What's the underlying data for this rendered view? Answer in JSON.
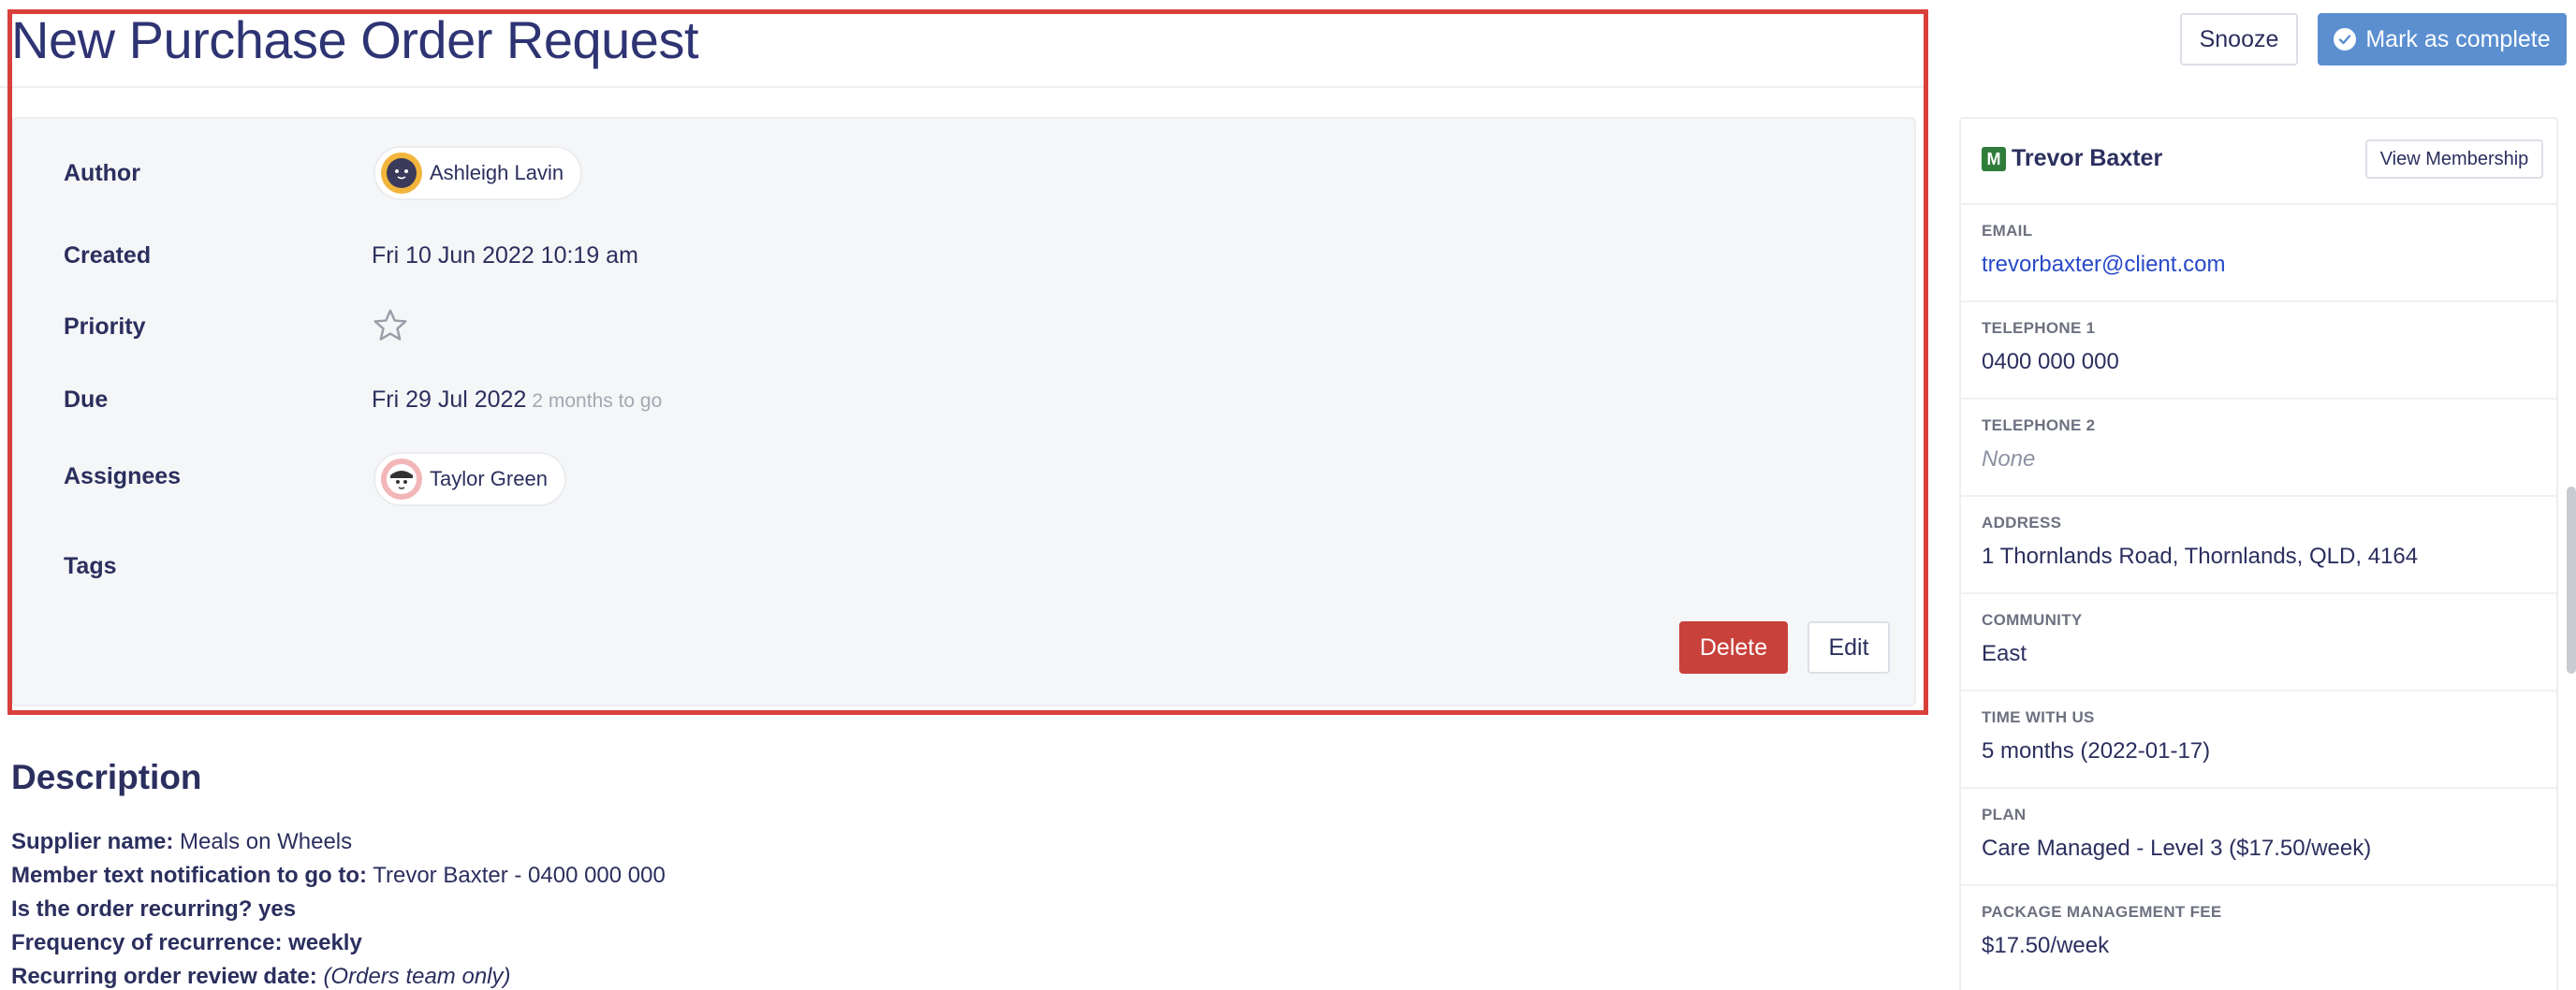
{
  "page": {
    "title": "New Purchase Order Request"
  },
  "header": {
    "snooze_label": "Snooze",
    "complete_label": "Mark as complete"
  },
  "details": {
    "author_label": "Author",
    "author_name": "Ashleigh Lavin",
    "created_label": "Created",
    "created_value": "Fri 10 Jun 2022 10:19 am",
    "priority_label": "Priority",
    "priority_icon": "star-outline-icon",
    "due_label": "Due",
    "due_value": "Fri 29 Jul 2022",
    "due_relative": "2 months to go",
    "assignees_label": "Assignees",
    "assignee_name": "Taylor Green",
    "tags_label": "Tags",
    "delete_label": "Delete",
    "edit_label": "Edit"
  },
  "description": {
    "heading": "Description",
    "lines": [
      {
        "label": "Supplier name:",
        "value": "Meals on Wheels"
      },
      {
        "label": "Member text notification to go to:",
        "value": "Trevor Baxter - 0400 000 000"
      },
      {
        "label": "Is the order recurring? yes",
        "value": ""
      },
      {
        "label": "Frequency of recurrence: weekly",
        "value": ""
      },
      {
        "label": "Recurring order review date:",
        "value": "(Orders team only)"
      }
    ]
  },
  "member": {
    "badge": "M",
    "name": "Trevor Baxter",
    "view_label": "View Membership",
    "fields": [
      {
        "label": "EMAIL",
        "value": "trevorbaxter@client.com"
      },
      {
        "label": "TELEPHONE 1",
        "value": "0400 000 000"
      },
      {
        "label": "TELEPHONE 2",
        "value": "None"
      },
      {
        "label": "ADDRESS",
        "value": "1 Thornlands Road, Thornlands, QLD, 4164"
      },
      {
        "label": "COMMUNITY",
        "value": "East"
      },
      {
        "label": "TIME WITH US",
        "value": "5 months (2022-01-17)"
      },
      {
        "label": "PLAN",
        "value": "Care Managed - Level 3 ($17.50/week)"
      },
      {
        "label": "PACKAGE MANAGEMENT FEE",
        "value": "$17.50/week"
      }
    ]
  },
  "colors": {
    "accent": "#5b8fd0",
    "danger": "#c8413b",
    "highlight": "#d9403c",
    "link": "#2849c8",
    "text": "#2b2f5e"
  }
}
